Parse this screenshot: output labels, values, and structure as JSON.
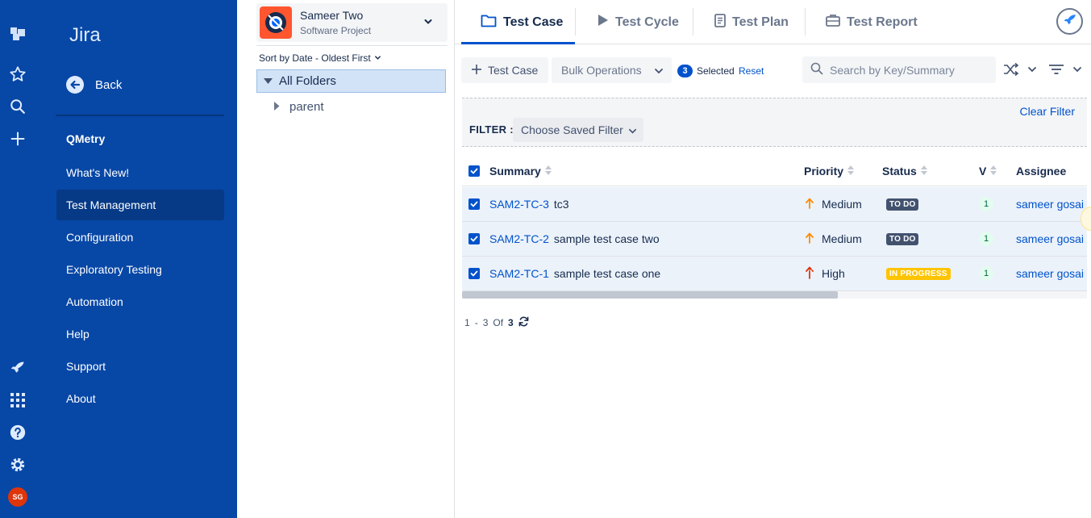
{
  "rail": {
    "avatar_initials": "SG",
    "icons": [
      "jira-logo-icon",
      "star-icon",
      "search-icon",
      "plus-icon",
      "rocket-icon",
      "apps-grid-icon",
      "help-icon",
      "gear-icon"
    ]
  },
  "sidebar": {
    "title": "Jira",
    "back_label": "Back",
    "heading": "QMetry",
    "items": [
      {
        "label": "What's New!"
      },
      {
        "label": "Test Management",
        "active": true
      },
      {
        "label": "Configuration"
      },
      {
        "label": "Exploratory Testing"
      },
      {
        "label": "Automation"
      },
      {
        "label": "Help"
      },
      {
        "label": "Support"
      },
      {
        "label": "About"
      }
    ]
  },
  "project": {
    "name": "Sameer Two",
    "type": "Software Project"
  },
  "folders": {
    "sort_label": "Sort by Date - Oldest First",
    "all_label": "All Folders",
    "children": [
      {
        "label": "parent"
      }
    ]
  },
  "tabs": [
    {
      "label": "Test Case",
      "icon": "folder-icon",
      "active": true
    },
    {
      "label": "Test Cycle",
      "icon": "play-icon"
    },
    {
      "label": "Test Plan",
      "icon": "document-icon"
    },
    {
      "label": "Test Report",
      "icon": "briefcase-icon"
    }
  ],
  "toolbar": {
    "add_label": "Test Case",
    "bulk_label": "Bulk Operations",
    "selected_count": "3",
    "selected_label": "Selected",
    "reset_label": "Reset",
    "search_placeholder": "Search by Key/Summary"
  },
  "filter": {
    "clear_label": "Clear Filter",
    "label": "FILTER :",
    "saved_filter_placeholder": "Choose Saved Filter"
  },
  "table": {
    "columns": {
      "summary": "Summary",
      "priority": "Priority",
      "status": "Status",
      "version": "V",
      "assignee": "Assignee"
    },
    "rows": [
      {
        "key": "SAM2-TC-3",
        "summary": "tc3",
        "priority": "Medium",
        "status": "TO DO",
        "version": "1",
        "assignee": "sameer gosai",
        "checked": true
      },
      {
        "key": "SAM2-TC-2",
        "summary": "sample test case two",
        "priority": "Medium",
        "status": "TO DO",
        "version": "1",
        "assignee": "sameer gosai",
        "checked": true
      },
      {
        "key": "SAM2-TC-1",
        "summary": "sample test case one",
        "priority": "High",
        "status": "IN PROGRESS",
        "version": "1",
        "assignee": "sameer gosai",
        "checked": true
      }
    ]
  },
  "pagination": {
    "from": "1",
    "dash": "-",
    "to": "3",
    "of_label": "Of",
    "total": "3"
  },
  "colors": {
    "sidebar_bg": "#0747a6",
    "accent": "#0052cc",
    "row_selected": "#ebf2fa",
    "status_todo": "#42526e",
    "status_in_progress": "#ffc400",
    "priority_medium": "#ff8b00",
    "priority_high": "#de350b"
  }
}
